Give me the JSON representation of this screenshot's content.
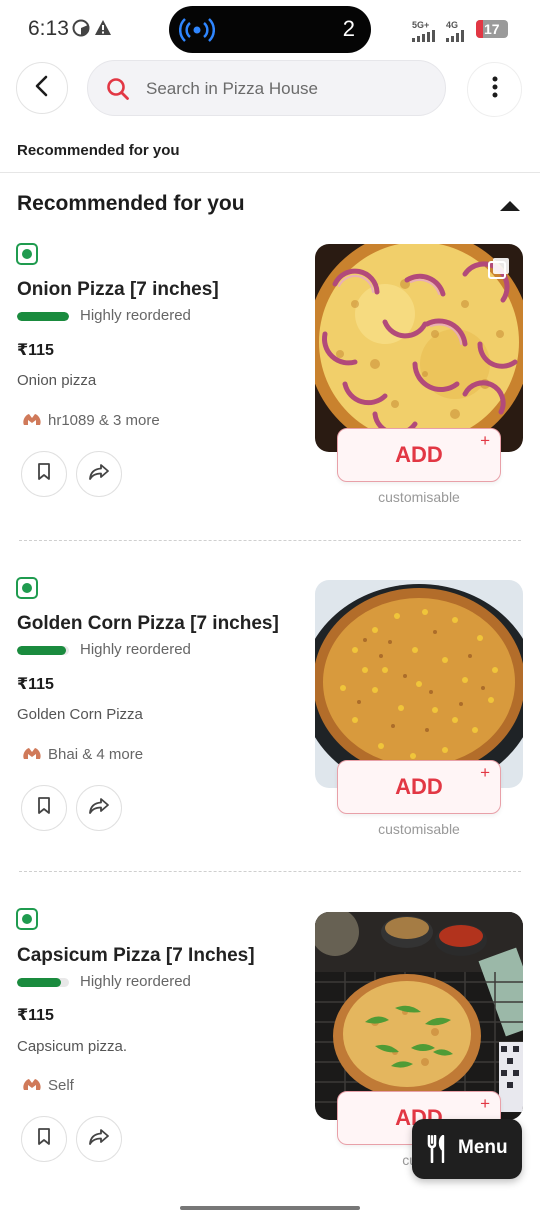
{
  "status_bar": {
    "time": "6:13",
    "pill_count": "2",
    "sig1": "5G+",
    "sig2": "4G",
    "battery": "17"
  },
  "search": {
    "placeholder": "Search in Pizza House"
  },
  "subheader": "Recommended for you",
  "section": {
    "title": "Recommended for you"
  },
  "items": [
    {
      "name": "Onion Pizza [7 inches]",
      "reorder_label": "Highly reordered",
      "reorder_level": 1.0,
      "price": "₹115",
      "description": "Onion pizza",
      "shared_by": "hr1089 & 3 more",
      "add_label": "ADD",
      "customisable": "customisable"
    },
    {
      "name": "Golden Corn Pizza [7 inches]",
      "reorder_label": "Highly reordered",
      "reorder_level": 0.95,
      "price": "₹115",
      "description": "Golden Corn Pizza",
      "shared_by": "Bhai & 4 more",
      "add_label": "ADD",
      "customisable": "customisable"
    },
    {
      "name": "Capsicum Pizza [7 Inches]",
      "reorder_label": "Highly reordered",
      "reorder_level": 0.85,
      "price": "₹115",
      "description": "Capsicum pizza.",
      "shared_by": "Self",
      "add_label": "ADD",
      "customisable": "custo"
    }
  ],
  "menu_button": {
    "label": "Menu"
  },
  "colors": {
    "accent": "#e23744",
    "veg": "#1f9b4f",
    "reorder": "#1a8b3e"
  }
}
